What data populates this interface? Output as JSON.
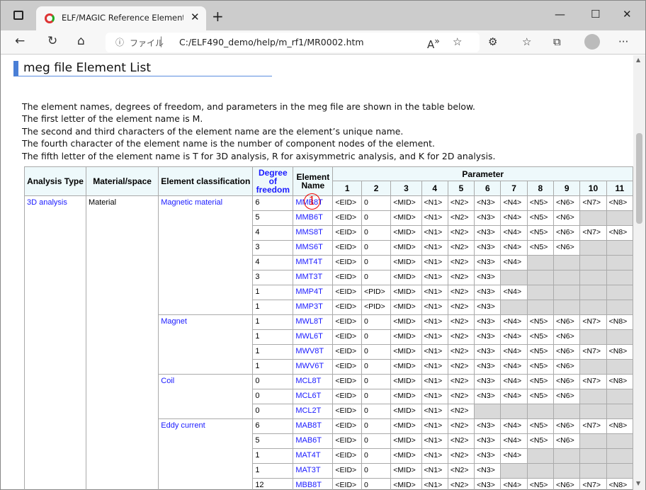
{
  "browser": {
    "tab_title": "ELF/MAGIC Reference Elements L",
    "file_label": "ファイル",
    "url": "C:/ELF490_demo/help/m_rf1/MR0002.htm"
  },
  "page": {
    "title": "meg file Element List",
    "intro": [
      "The element names, degrees of freedom, and parameters in the meg file are shown in the table below.",
      "The first letter of the element name is M.",
      "The second and third characters of the element name are the element’s unique name.",
      "The fourth character of the element name is the number of component nodes of the element.",
      "The fifth letter of the element name is T for 3D analysis, R for axisymmetric analysis, and K for 2D analysis."
    ]
  },
  "marker": "1",
  "table": {
    "headers": {
      "analysis_type": "Analysis Type",
      "material_space": "Material/space",
      "element_classification": "Element classification",
      "dof": "Degree of freedom",
      "element_name": "Element Name",
      "parameter": "Parameter",
      "param_numbers": [
        "1",
        "2",
        "3",
        "4",
        "5",
        "6",
        "7",
        "8",
        "9",
        "10",
        "11"
      ]
    },
    "analysis_type": "3D analysis",
    "material_space": "Material",
    "groups": [
      {
        "classification": "Magnetic material",
        "rows": [
          [
            "6",
            "MMB8T",
            11
          ],
          [
            "5",
            "MMB6T",
            9
          ],
          [
            "4",
            "MMS8T",
            11
          ],
          [
            "3",
            "MMS6T",
            9
          ],
          [
            "4",
            "MMT4T",
            7
          ],
          [
            "3",
            "MMT3T",
            6
          ],
          [
            "1",
            "MMP4T",
            7,
            "<PID>"
          ],
          [
            "1",
            "MMP3T",
            6,
            "<PID>"
          ]
        ]
      },
      {
        "classification": "Magnet",
        "rows": [
          [
            "1",
            "MWL8T",
            11
          ],
          [
            "1",
            "MWL6T",
            9
          ],
          [
            "1",
            "MWV8T",
            11
          ],
          [
            "1",
            "MWV6T",
            9
          ]
        ]
      },
      {
        "classification": "Coil",
        "rows": [
          [
            "0",
            "MCL8T",
            11
          ],
          [
            "0",
            "MCL6T",
            9
          ],
          [
            "0",
            "MCL2T",
            5
          ]
        ]
      },
      {
        "classification": "Eddy current",
        "rows": [
          [
            "6",
            "MAB8T",
            11
          ],
          [
            "5",
            "MAB6T",
            9
          ],
          [
            "1",
            "MAT4T",
            7
          ],
          [
            "1",
            "MAT3T",
            6
          ],
          [
            "12",
            "MBB8T",
            11
          ]
        ]
      }
    ],
    "params": [
      "<EID>",
      "0",
      "<MID>",
      "<N1>",
      "<N2>",
      "<N3>",
      "<N4>",
      "<N5>",
      "<N6>",
      "<N7>",
      "<N8>"
    ]
  }
}
